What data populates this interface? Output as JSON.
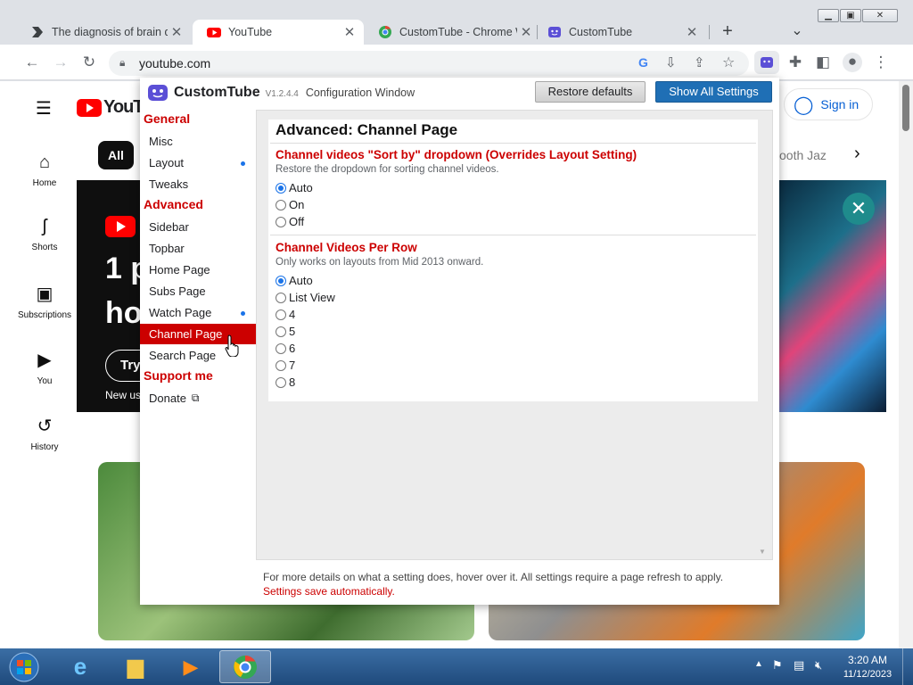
{
  "tabs": [
    {
      "title": "The diagnosis of brain d",
      "close": "✕"
    },
    {
      "title": "YouTube",
      "close": "✕"
    },
    {
      "title": "CustomTube - Chrome W",
      "close": "✕"
    },
    {
      "title": "CustomTube",
      "close": "✕"
    }
  ],
  "new_tab": "+",
  "tab_list": "⌄",
  "url": "youtube.com",
  "youtube": {
    "logo": "YouTube",
    "sign_in": "Sign in",
    "chip_all": "All",
    "chip_partial": "ooth Jaz",
    "sidebar": [
      {
        "icon": "⌂",
        "label": "Home"
      },
      {
        "icon": "ʃ",
        "label": "Shorts"
      },
      {
        "icon": "▣",
        "label": "Subscriptions"
      },
      {
        "icon": "▶",
        "label": "You"
      },
      {
        "icon": "↺",
        "label": "History"
      }
    ],
    "banner_text_1": "1 p",
    "banner_text_2": "ho",
    "banner_try": "Try",
    "banner_new": "New us"
  },
  "popup": {
    "brand": "CustomTube",
    "version": "V1.2.4.4",
    "subtitle": "Configuration Window",
    "restore_btn": "Restore defaults",
    "show_all_btn": "Show All Settings",
    "nav": {
      "general": "General",
      "misc": "Misc",
      "layout": "Layout",
      "tweaks": "Tweaks",
      "advanced": "Advanced",
      "sidebar": "Sidebar",
      "topbar": "Topbar",
      "home_page": "Home Page",
      "subs_page": "Subs Page",
      "watch_page": "Watch Page",
      "channel_page": "Channel Page",
      "search_page": "Search Page",
      "support": "Support me",
      "donate": "Donate"
    },
    "heading": "Advanced: Channel Page",
    "section1": {
      "title": "Channel videos \"Sort by\" dropdown (Overrides Layout Setting)",
      "desc": "Restore the dropdown for sorting channel videos.",
      "options": [
        "Auto",
        "On",
        "Off"
      ],
      "selected": "Auto"
    },
    "section2": {
      "title": "Channel Videos Per Row",
      "desc": "Only works on layouts from Mid 2013 onward.",
      "options": [
        "Auto",
        "List View",
        "4",
        "5",
        "6",
        "7",
        "8"
      ],
      "selected": "Auto"
    },
    "footer": "For more details on what a setting does, hover over it. All settings require a page refresh to apply.",
    "footer_red": "Settings save automatically."
  },
  "clock": {
    "time": "3:20 AM",
    "date": "11/12/2023"
  },
  "colors": {
    "accent_red": "#cc0000",
    "blue": "#1a73e8"
  }
}
